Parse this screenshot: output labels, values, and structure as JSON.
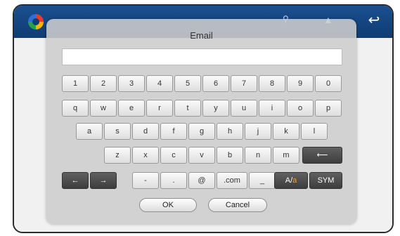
{
  "dialog": {
    "title": "Email",
    "input_value": ""
  },
  "keyboard": {
    "row1": [
      "1",
      "2",
      "3",
      "4",
      "5",
      "6",
      "7",
      "8",
      "9",
      "0"
    ],
    "row2": [
      "q",
      "w",
      "e",
      "r",
      "t",
      "y",
      "u",
      "i",
      "o",
      "p"
    ],
    "row3": [
      "a",
      "s",
      "d",
      "f",
      "g",
      "h",
      "j",
      "k",
      "l"
    ],
    "row4": [
      "z",
      "x",
      "c",
      "v",
      "b",
      "n",
      "m"
    ],
    "row5": {
      "dash": "-",
      "dot": ".",
      "at": "@",
      "dotcom": ".com",
      "underscore": "_",
      "case_a": "A/",
      "case_b": "a",
      "sym": "SYM"
    },
    "arrow_left": "←",
    "arrow_right": "→",
    "backspace": "⟵"
  },
  "buttons": {
    "ok": "OK",
    "cancel": "Cancel"
  },
  "colors": {
    "topbar": "#0f3c73",
    "accent": "#ff9a2a",
    "watermark": "#1c55a3"
  }
}
